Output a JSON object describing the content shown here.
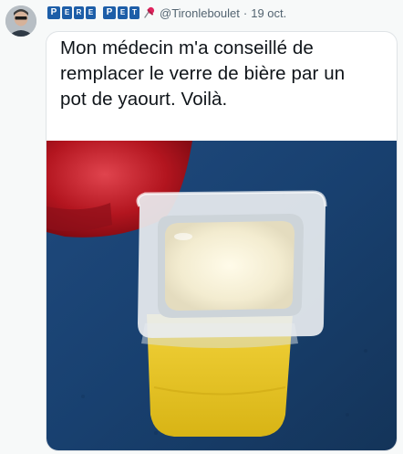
{
  "tweet": {
    "display_name_blocks": [
      "P",
      "E",
      "R",
      "E",
      "P",
      "E",
      "T"
    ],
    "handle": "@Tironleboulet",
    "separator": "·",
    "date": "19 oct.",
    "text": "Mon médecin m'a conseillé de\nremplacer le verre de bière par un\npot de yaourt. Voilà."
  },
  "icons": {
    "pin": "pushpin-icon",
    "avatar": "user-avatar"
  },
  "colors": {
    "block_blue": "#1d5ea8",
    "pin_red": "#e0245e",
    "handle_gray": "#536471"
  }
}
